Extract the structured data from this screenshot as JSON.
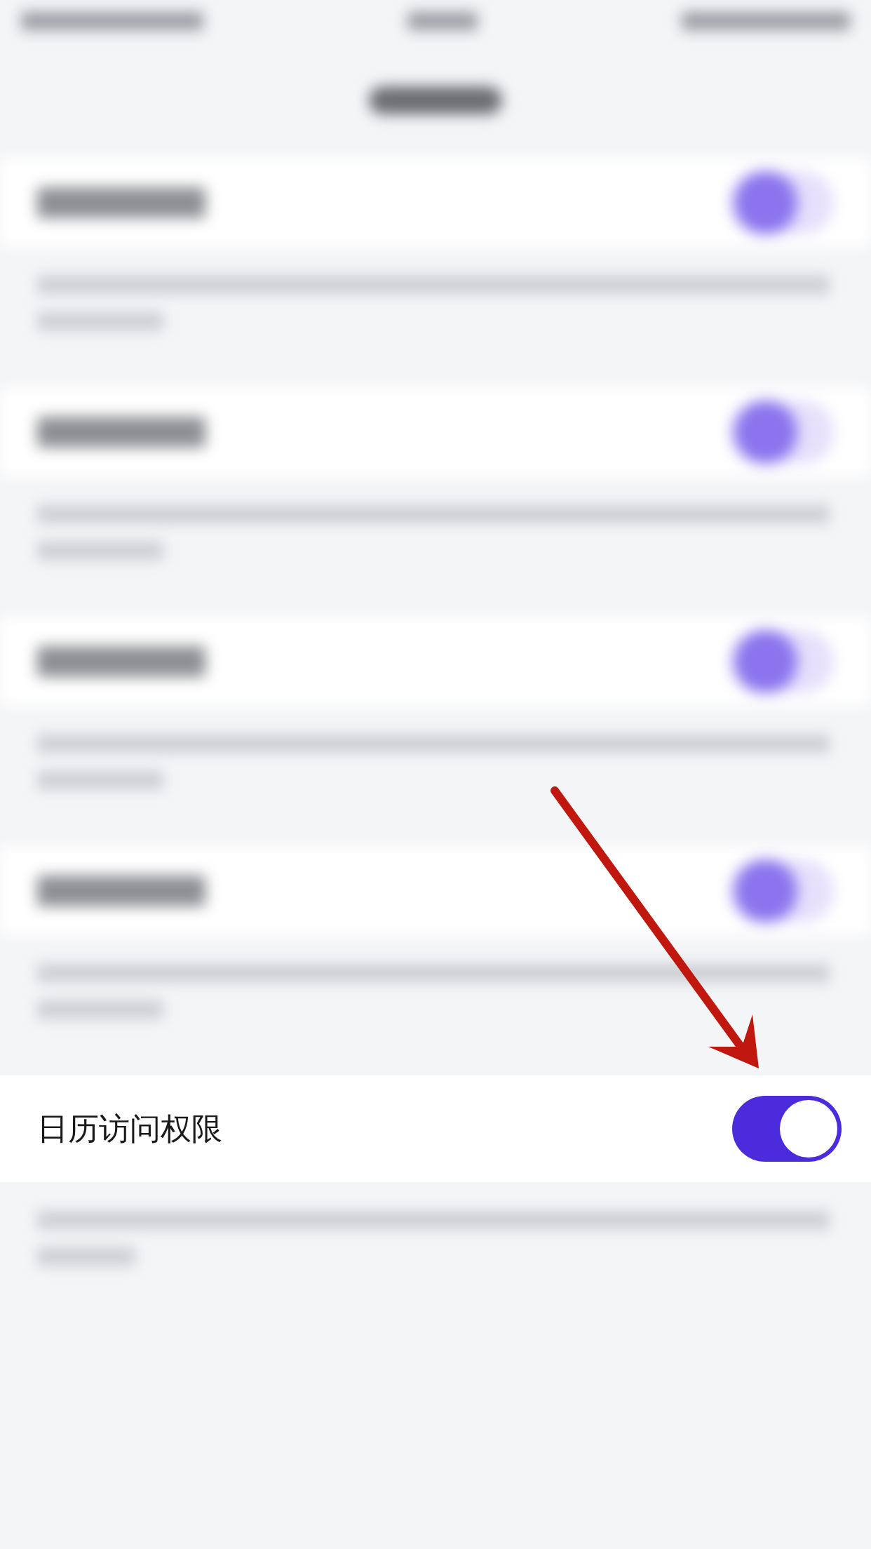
{
  "rows": [
    {
      "kind": "blurred",
      "on": true
    },
    {
      "kind": "blurred",
      "on": true
    },
    {
      "kind": "blurred",
      "on": true
    },
    {
      "kind": "blurred",
      "on": true
    },
    {
      "kind": "focused",
      "label": "日历访问权限",
      "on": true
    }
  ]
}
